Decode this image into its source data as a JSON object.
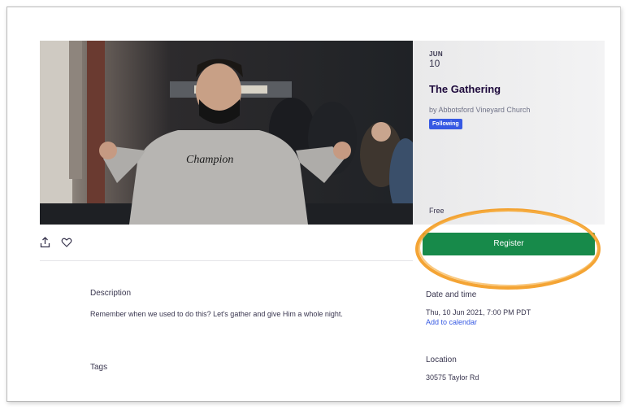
{
  "event": {
    "month": "JUN",
    "day": "10",
    "title": "The Gathering",
    "organizer": "by Abbotsford Vineyard Church",
    "follow_label": "Following",
    "price": "Free"
  },
  "actions": {
    "register_label": "Register",
    "share_icon": "share-icon",
    "like_icon": "heart-icon"
  },
  "description": {
    "heading": "Description",
    "text": "Remember when we used to do this? Let's gather and give Him a whole night."
  },
  "tags": {
    "heading": "Tags"
  },
  "datetime": {
    "heading": "Date and time",
    "value": "Thu, 10 Jun 2021, 7:00 PM PDT",
    "calendar_link": "Add to calendar"
  },
  "location": {
    "heading": "Location",
    "address": "30575 Taylor Rd"
  },
  "hero": {
    "shirt_text": "Champion"
  },
  "colors": {
    "register": "#178a4a",
    "follow": "#3659e3",
    "link": "#3659e3",
    "annotation": "#f39a1e"
  }
}
